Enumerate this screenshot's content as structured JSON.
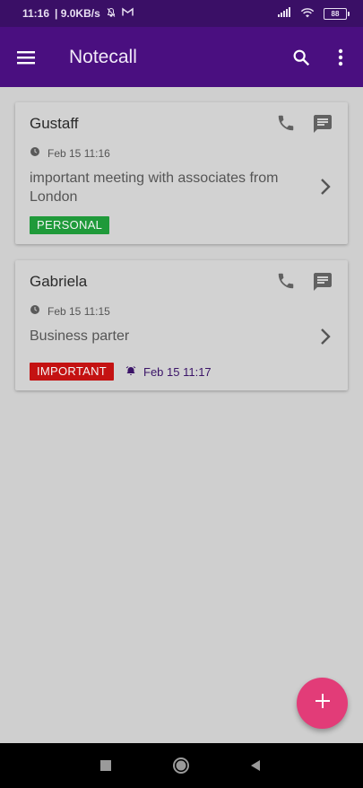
{
  "status_bar": {
    "time": "11:16",
    "speed": "| 9.0KB/s",
    "battery": "88"
  },
  "app_bar": {
    "title": "Notecall",
    "icons": [
      "menu-icon",
      "search-icon",
      "more-vert-icon"
    ]
  },
  "notes": [
    {
      "name": "Gustaff",
      "time": "Feb 15 11:16",
      "note": "important meeting with associates from London",
      "tag": "PERSONAL",
      "tag_color": "#1f9a3a"
    },
    {
      "name": "Gabriela",
      "time": "Feb 15 11:15",
      "note": "Business parter",
      "tag": "IMPORTANT",
      "tag_color": "#c41212",
      "reminder": "Feb 15 11:17"
    }
  ],
  "colors": {
    "status_bar": "#3a0f66",
    "app_bar": "#4a0f80",
    "background": "#cfcfcf",
    "fab": "#e23c78",
    "reminder_text": "#3b1468"
  },
  "fab": {
    "icon": "plus-icon"
  },
  "nav_bar": {
    "icons": [
      "recents-square-icon",
      "home-circle-icon",
      "back-triangle-icon"
    ]
  }
}
